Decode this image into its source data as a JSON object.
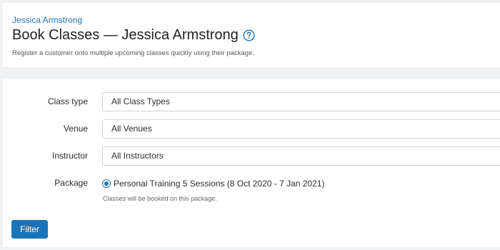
{
  "header": {
    "breadcrumb": "Jessica Armstrong",
    "title": "Book Classes — Jessica Armstrong",
    "subtitle": "Register a customer onto multiple upcoming classes quickly using their package."
  },
  "form": {
    "class_type": {
      "label": "Class type",
      "value": "All Class Types"
    },
    "venue": {
      "label": "Venue",
      "value": "All Venues"
    },
    "instructor": {
      "label": "Instructor",
      "value": "All Instructors"
    },
    "package": {
      "label": "Package",
      "option": "Personal Training 5 Sessions (8 Oct 2020 - 7 Jan 2021)",
      "help": "Classes will be booked on this package."
    },
    "filter_label": "Filter"
  },
  "icons": {
    "help": "question-circle-icon"
  },
  "colors": {
    "accent": "#1b74b8",
    "background": "#f0f1f3"
  }
}
